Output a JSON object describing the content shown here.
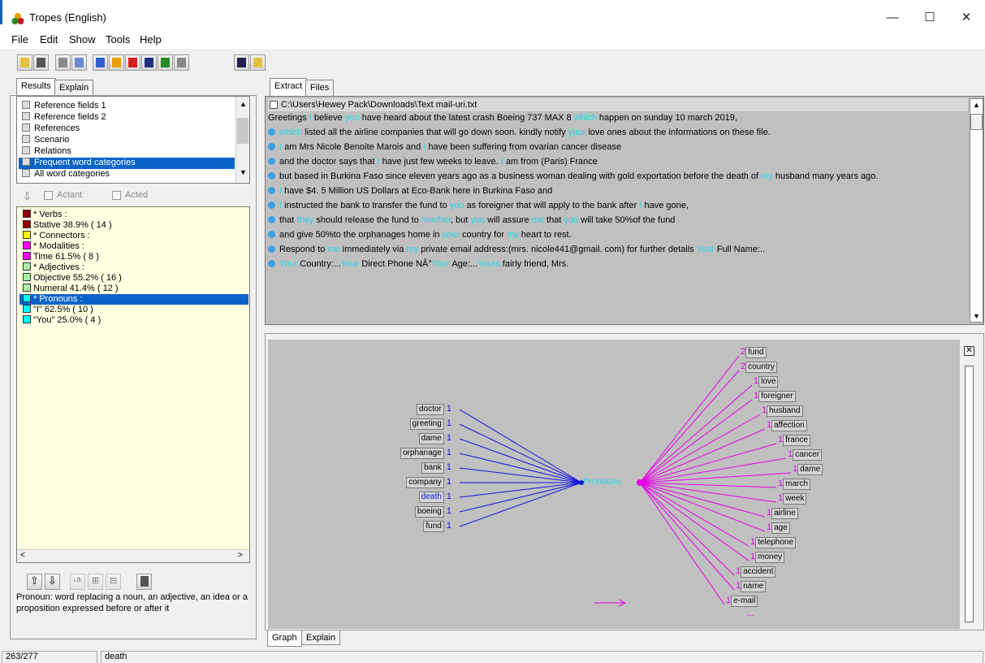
{
  "window": {
    "title": "Tropes (English)"
  },
  "menu": [
    "File",
    "Edit",
    "Show",
    "Tools",
    "Help"
  ],
  "left_tabs": [
    "Results",
    "Explain"
  ],
  "results_list": {
    "items": [
      "Reference fields 1",
      "Reference fields 2",
      "References",
      "Scenario",
      "Relations",
      "Frequent word categories",
      "All word categories"
    ],
    "selected": "Frequent word categories"
  },
  "filters": {
    "actant": "Actant",
    "acted": "Acted"
  },
  "categories": [
    {
      "label": "* Verbs :",
      "color": "#8b0000",
      "selected": false
    },
    {
      "label": "Stative  38.9% ( 14 )",
      "color": "#8b0000",
      "selected": false
    },
    {
      "label": "* Connectors :",
      "color": "#ffff00",
      "selected": false
    },
    {
      "label": "* Modalities :",
      "color": "#ff00ff",
      "selected": false
    },
    {
      "label": "Time  61.5% ( 8 )",
      "color": "#ff00ff",
      "selected": false
    },
    {
      "label": "* Adjectives :",
      "color": "#a8f0a8",
      "selected": false
    },
    {
      "label": "Objective  55.2% ( 16 )",
      "color": "#a8f0a8",
      "selected": false
    },
    {
      "label": "Numeral  41.4% ( 12 )",
      "color": "#a8f0a8",
      "selected": false
    },
    {
      "label": "* Pronouns :",
      "color": "#00ffff",
      "selected": true
    },
    {
      "label": "\"I\"  62.5% ( 10 )",
      "color": "#00ffff",
      "selected": false
    },
    {
      "label": "\"You\"  25.0% ( 4 )",
      "color": "#00ffff",
      "selected": false
    }
  ],
  "explain_text": "Pronoun: word replacing a noun, an adjective, an idea or a proposition expressed before or after it",
  "right_tabs": [
    "Extract",
    "Files"
  ],
  "extract": {
    "file_path": "C:\\Users\\Hewey Pack\\Downloads\\Text mail-uri.txt",
    "lines": [
      {
        "bullet": false,
        "parts": [
          [
            "Greetings ",
            0
          ],
          [
            "I",
            1
          ],
          [
            " believe ",
            0
          ],
          [
            "you",
            1
          ],
          [
            " have heard about the latest crash Boeing 737 MAX 8 ",
            0
          ],
          [
            "which",
            1
          ],
          [
            " happen on sunday 10 march 2019,",
            0
          ]
        ]
      },
      {
        "bullet": true,
        "parts": [
          [
            "which",
            1
          ],
          [
            " listed all the airline companies that will go down soon. kindly notify ",
            0
          ],
          [
            "your",
            1
          ],
          [
            " love ones about the informations on these file.",
            0
          ]
        ]
      },
      {
        "bullet": true,
        "parts": [
          [
            "I",
            1
          ],
          [
            " am Mrs Nicole Benoite Marois and ",
            0
          ],
          [
            "I",
            1
          ],
          [
            " have been suffering from ovarian cancer disease",
            0
          ]
        ]
      },
      {
        "bullet": true,
        "parts": [
          [
            "and the doctor says that ",
            0
          ],
          [
            "I",
            1
          ],
          [
            " have just few weeks to leave. ",
            0
          ],
          [
            "I",
            1
          ],
          [
            " am from (Paris) France",
            0
          ]
        ]
      },
      {
        "bullet": true,
        "parts": [
          [
            "but based in Burkina Faso since eleven years ago as a business woman dealing with gold exportation before the death of ",
            0
          ],
          [
            "my",
            1
          ],
          [
            " husband many years ago.",
            0
          ]
        ]
      },
      {
        "bullet": true,
        "parts": [
          [
            "I",
            1
          ],
          [
            " have $4. 5 Million US Dollars at Eco-Bank here in Burkina Faso and",
            0
          ]
        ]
      },
      {
        "bullet": true,
        "parts": [
          [
            "I",
            1
          ],
          [
            " instructed the bank to transfer the fund to ",
            0
          ],
          [
            "you",
            1
          ],
          [
            " as foreigner that will apply to the bank after ",
            0
          ],
          [
            "I",
            1
          ],
          [
            " have gone,",
            0
          ]
        ]
      },
      {
        "bullet": true,
        "parts": [
          [
            "that ",
            0
          ],
          [
            "they",
            1
          ],
          [
            " should release the fund to ",
            0
          ],
          [
            "him/her",
            1
          ],
          [
            ",  but ",
            0
          ],
          [
            "you",
            1
          ],
          [
            " will assure ",
            0
          ],
          [
            "me",
            1
          ],
          [
            " that ",
            0
          ],
          [
            "you",
            1
          ],
          [
            " will take 50%of the fund",
            0
          ]
        ]
      },
      {
        "bullet": true,
        "parts": [
          [
            "and give 50%to the orphanages home in ",
            0
          ],
          [
            "your",
            1
          ],
          [
            " country for ",
            0
          ],
          [
            "my",
            1
          ],
          [
            " heart to rest.",
            0
          ]
        ]
      },
      {
        "bullet": true,
        "parts": [
          [
            "Respond to ",
            0
          ],
          [
            "me",
            1
          ],
          [
            " immediately via ",
            0
          ],
          [
            "my",
            1
          ],
          [
            " private email address:(mrs. nicole441@gmail. com) for further details ",
            0
          ],
          [
            "Your",
            1
          ],
          [
            " Full Name:..",
            0
          ]
        ]
      },
      {
        "bullet": true,
        "parts": [
          [
            "Your",
            1
          ],
          [
            " Country:...",
            0
          ],
          [
            "Your",
            1
          ],
          [
            " Direct Phone NÂ°",
            0
          ],
          [
            "Your",
            1
          ],
          [
            " Age:...",
            0
          ],
          [
            "Yours",
            1
          ],
          [
            " fairly friend, Mrs.",
            0
          ]
        ]
      }
    ]
  },
  "graph": {
    "center": "Pronouns",
    "left_words": [
      {
        "word": "doctor",
        "count": "1",
        "highlight": false
      },
      {
        "word": "greeting",
        "count": "1",
        "highlight": false
      },
      {
        "word": "dame",
        "count": "1",
        "highlight": false
      },
      {
        "word": "orphanage",
        "count": "1",
        "highlight": false
      },
      {
        "word": "bank",
        "count": "1",
        "highlight": false
      },
      {
        "word": "company",
        "count": "1",
        "highlight": false
      },
      {
        "word": "death",
        "count": "1",
        "highlight": true
      },
      {
        "word": "boeing",
        "count": "1",
        "highlight": false
      },
      {
        "word": "fund",
        "count": "1",
        "highlight": false
      }
    ],
    "right_words": [
      {
        "word": "fund",
        "count": "2"
      },
      {
        "word": "country",
        "count": "2"
      },
      {
        "word": "love",
        "count": "1"
      },
      {
        "word": "foreigner",
        "count": "1"
      },
      {
        "word": "husband",
        "count": "1"
      },
      {
        "word": "affection",
        "count": "1"
      },
      {
        "word": "france",
        "count": "1"
      },
      {
        "word": "cancer",
        "count": "1"
      },
      {
        "word": "dame",
        "count": "1"
      },
      {
        "word": "march",
        "count": "1"
      },
      {
        "word": "week",
        "count": "1"
      },
      {
        "word": "airline",
        "count": "1"
      },
      {
        "word": "age",
        "count": "1"
      },
      {
        "word": "telephone",
        "count": "1"
      },
      {
        "word": "money",
        "count": "1"
      },
      {
        "word": "accident",
        "count": "1"
      },
      {
        "word": "name",
        "count": "1"
      },
      {
        "word": "e-mail",
        "count": "1"
      }
    ],
    "more": "..."
  },
  "bottom_tabs": [
    "Graph",
    "Explain"
  ],
  "status": {
    "count": "263/277",
    "word": "death"
  }
}
